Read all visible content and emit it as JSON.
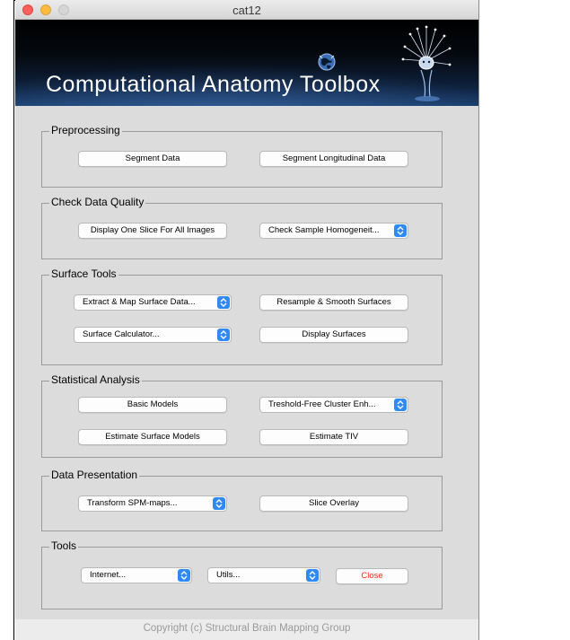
{
  "window": {
    "title": "cat12"
  },
  "banner": {
    "title": "Computational Anatomy Toolbox"
  },
  "sections": {
    "preprocessing": {
      "title": "Preprocessing",
      "segment_data": "Segment Data",
      "segment_longitudinal": "Segment Longitudinal Data"
    },
    "check_quality": {
      "title": "Check Data Quality",
      "display_one_slice": "Display One Slice For All Images",
      "check_sample_homogeneity": "Check Sample Homogeneit..."
    },
    "surface_tools": {
      "title": "Surface Tools",
      "extract_map": "Extract & Map Surface Data...",
      "resample_smooth": "Resample & Smooth Surfaces",
      "surface_calculator": "Surface Calculator...",
      "display_surfaces": "Display Surfaces"
    },
    "statistical_analysis": {
      "title": "Statistical Analysis",
      "basic_models": "Basic Models",
      "tfce": "Treshold-Free Cluster Enh...",
      "estimate_surface_models": "Estimate Surface Models",
      "estimate_tiv": "Estimate TIV"
    },
    "data_presentation": {
      "title": "Data Presentation",
      "transform_spm_maps": "Transform SPM-maps...",
      "slice_overlay": "Slice Overlay"
    },
    "tools": {
      "title": "Tools",
      "internet": "Internet...",
      "utils": "Utils...",
      "close": "Close"
    }
  },
  "footer": {
    "copyright": "Copyright (c) Structural Brain Mapping Group"
  },
  "colors": {
    "close_text": "#ff2a1a",
    "popup_accent": "#2f8af5",
    "banner_dark": "#000000",
    "banner_blue": "#1a3d6b"
  }
}
